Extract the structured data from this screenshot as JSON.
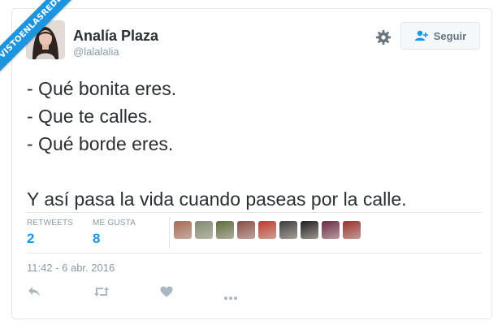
{
  "watermark": "VISTOENLASREDES",
  "tweet": {
    "author_name": "Analía Plaza",
    "author_handle": "@lalalalia",
    "follow_label": "Seguir",
    "lines": [
      "- Qué bonita eres.",
      "- Que te calles.",
      "- Qué borde eres.",
      "",
      "Y así pasa la vida cuando paseas por la calle."
    ],
    "stats": {
      "retweets_label": "RETWEETS",
      "retweets_count": "2",
      "likes_label": "ME GUSTA",
      "likes_count": "8"
    },
    "timestamp": "11:42 - 6 abr. 2016"
  },
  "icons": {
    "settings": "gear-icon",
    "follow": "add-user-icon",
    "reply": "reply-icon",
    "retweet": "retweet-icon",
    "like": "heart-icon",
    "more": "more-icon"
  },
  "colors": {
    "accent": "#1b95e0",
    "muted": "#8899a6",
    "text": "#292f33",
    "border": "#e1e8ed"
  },
  "likers": [
    {
      "color": "#a86a52"
    },
    {
      "color": "#7f8b6d"
    },
    {
      "color": "#5d6e3b"
    },
    {
      "color": "#8a4d44"
    },
    {
      "color": "#c23a2c"
    },
    {
      "color": "#3d3d3d"
    },
    {
      "color": "#1e1e1e"
    },
    {
      "color": "#6e2a45"
    },
    {
      "color": "#9c2f2a"
    }
  ]
}
